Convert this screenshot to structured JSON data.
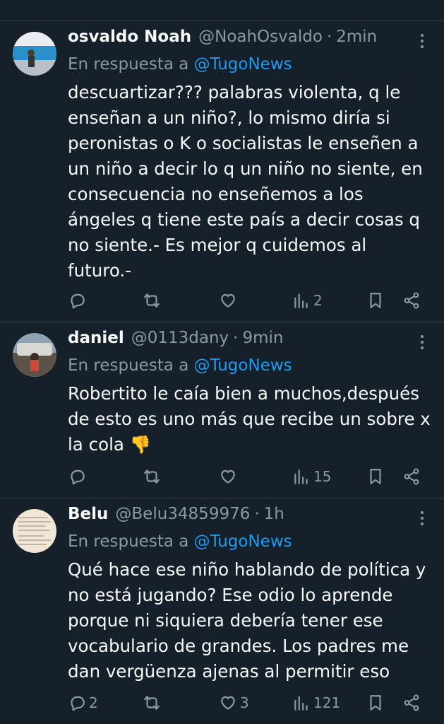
{
  "tweets": [
    {
      "name": "osvaldo Noah",
      "handle": "@NoahOsvaldo",
      "dot": "·",
      "time": "2min",
      "reply_prefix": "En respuesta a",
      "reply_to": "@TugoNews",
      "lines": [
        "descuartizar??? palabras violenta, q le",
        "enseñan a un niño?, lo mismo diría si",
        "peronistas o K o socialistas le enseñen a",
        "un niño a decir lo q un niño no siente, en",
        "consecuencia no enseñemos a los",
        "ángeles q tiene este país a decir cosas q",
        "no siente.- Es mejor q cuidemos al",
        "futuro.-"
      ],
      "replies": "",
      "retweets": "",
      "likes": "",
      "views": "2"
    },
    {
      "name": "daniel",
      "handle": "@0113dany",
      "dot": "·",
      "time": "9min",
      "reply_prefix": "En respuesta a",
      "reply_to": "@TugoNews",
      "lines": [
        "Robertito le caía bien a muchos,después",
        "de esto es uno más que recibe un sobre x",
        "la cola 👎"
      ],
      "replies": "",
      "retweets": "",
      "likes": "",
      "views": "15"
    },
    {
      "name": "Belu",
      "handle": "@Belu34859976",
      "dot": "·",
      "time": "1h",
      "reply_prefix": "En respuesta a",
      "reply_to": "@TugoNews",
      "lines": [
        "Qué hace ese niño hablando de política y",
        "no está jugando? Ese odio lo aprende",
        "porque ni siquiera debería tener ese",
        "vocabulario de grandes. Los padres me",
        "dan vergüenza ajenas al permitir eso"
      ],
      "replies": "2",
      "retweets": "",
      "likes": "3",
      "views": "121"
    }
  ],
  "colors": {
    "background": "#15202b",
    "text": "#f7f9f9",
    "muted": "#8b98a5",
    "link": "#1d9bf0",
    "divider": "#38444d"
  },
  "icons": [
    "reply-icon",
    "retweet-icon",
    "like-icon",
    "views-icon",
    "bookmark-icon",
    "share-icon",
    "more-icon"
  ]
}
